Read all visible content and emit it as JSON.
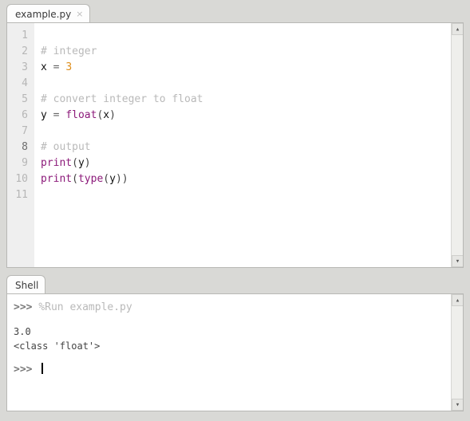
{
  "editor": {
    "tab_label": "example.py",
    "current_line": 8,
    "lines": [
      {
        "num": 1,
        "tokens": []
      },
      {
        "num": 2,
        "tokens": [
          {
            "t": "# integer",
            "c": "c-comment"
          }
        ]
      },
      {
        "num": 3,
        "tokens": [
          {
            "t": "x ",
            "c": "c-ident"
          },
          {
            "t": "= ",
            "c": "c-op"
          },
          {
            "t": "3",
            "c": "c-num"
          }
        ]
      },
      {
        "num": 4,
        "tokens": []
      },
      {
        "num": 5,
        "tokens": [
          {
            "t": "# convert integer to float",
            "c": "c-comment"
          }
        ]
      },
      {
        "num": 6,
        "tokens": [
          {
            "t": "y ",
            "c": "c-ident"
          },
          {
            "t": "= ",
            "c": "c-op"
          },
          {
            "t": "float",
            "c": "c-builtin"
          },
          {
            "t": "(",
            "c": "c-paren"
          },
          {
            "t": "x",
            "c": "c-ident"
          },
          {
            "t": ")",
            "c": "c-paren"
          }
        ]
      },
      {
        "num": 7,
        "tokens": []
      },
      {
        "num": 8,
        "tokens": [
          {
            "t": "# output",
            "c": "c-comment"
          }
        ]
      },
      {
        "num": 9,
        "tokens": [
          {
            "t": "print",
            "c": "c-builtin"
          },
          {
            "t": "(",
            "c": "c-paren"
          },
          {
            "t": "y",
            "c": "c-ident"
          },
          {
            "t": ")",
            "c": "c-paren"
          }
        ]
      },
      {
        "num": 10,
        "tokens": [
          {
            "t": "print",
            "c": "c-builtin"
          },
          {
            "t": "(",
            "c": "c-paren"
          },
          {
            "t": "type",
            "c": "c-builtin"
          },
          {
            "t": "(",
            "c": "c-paren"
          },
          {
            "t": "y",
            "c": "c-ident"
          },
          {
            "t": ")",
            "c": "c-paren"
          },
          {
            "t": ")",
            "c": "c-paren"
          }
        ]
      },
      {
        "num": 11,
        "tokens": []
      }
    ]
  },
  "shell": {
    "tab_label": "Shell",
    "prompt": ">>>",
    "run_command": "%Run example.py",
    "output": [
      "3.0",
      "<class 'float'>"
    ]
  }
}
